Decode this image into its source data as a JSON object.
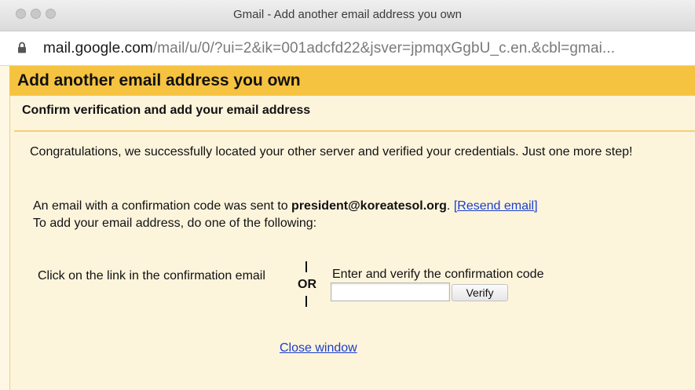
{
  "window": {
    "title": "Gmail - Add another email address you own"
  },
  "address_bar": {
    "host": "mail.google.com",
    "path": "/mail/u/0/?ui=2&ik=001adcfd22&jsver=jpmqxGgbU_c.en.&cbl=gmai..."
  },
  "dialog": {
    "title": "Add another email address you own",
    "subheading": "Confirm verification and add your email address",
    "congrats": "Congratulations, we successfully located your other server and verified your credentials. Just one more step!",
    "sent_prefix": "An email with a confirmation code was sent to ",
    "email": "president@koreatesol.org",
    "sent_suffix": ". ",
    "resend_open": "[",
    "resend_label": "Resend email",
    "resend_close": "]",
    "instruction": "To add your email address, do one of the following:",
    "option_link": "Click on the link in the confirmation email",
    "or_label": "OR",
    "option_code": "Enter and verify the confirmation code",
    "code_value": "",
    "verify_label": "Verify",
    "close_label": "Close window"
  },
  "colors": {
    "header_bg": "#f6c341",
    "panel_bg": "#fdf4dc",
    "link": "#1a3ec9"
  }
}
